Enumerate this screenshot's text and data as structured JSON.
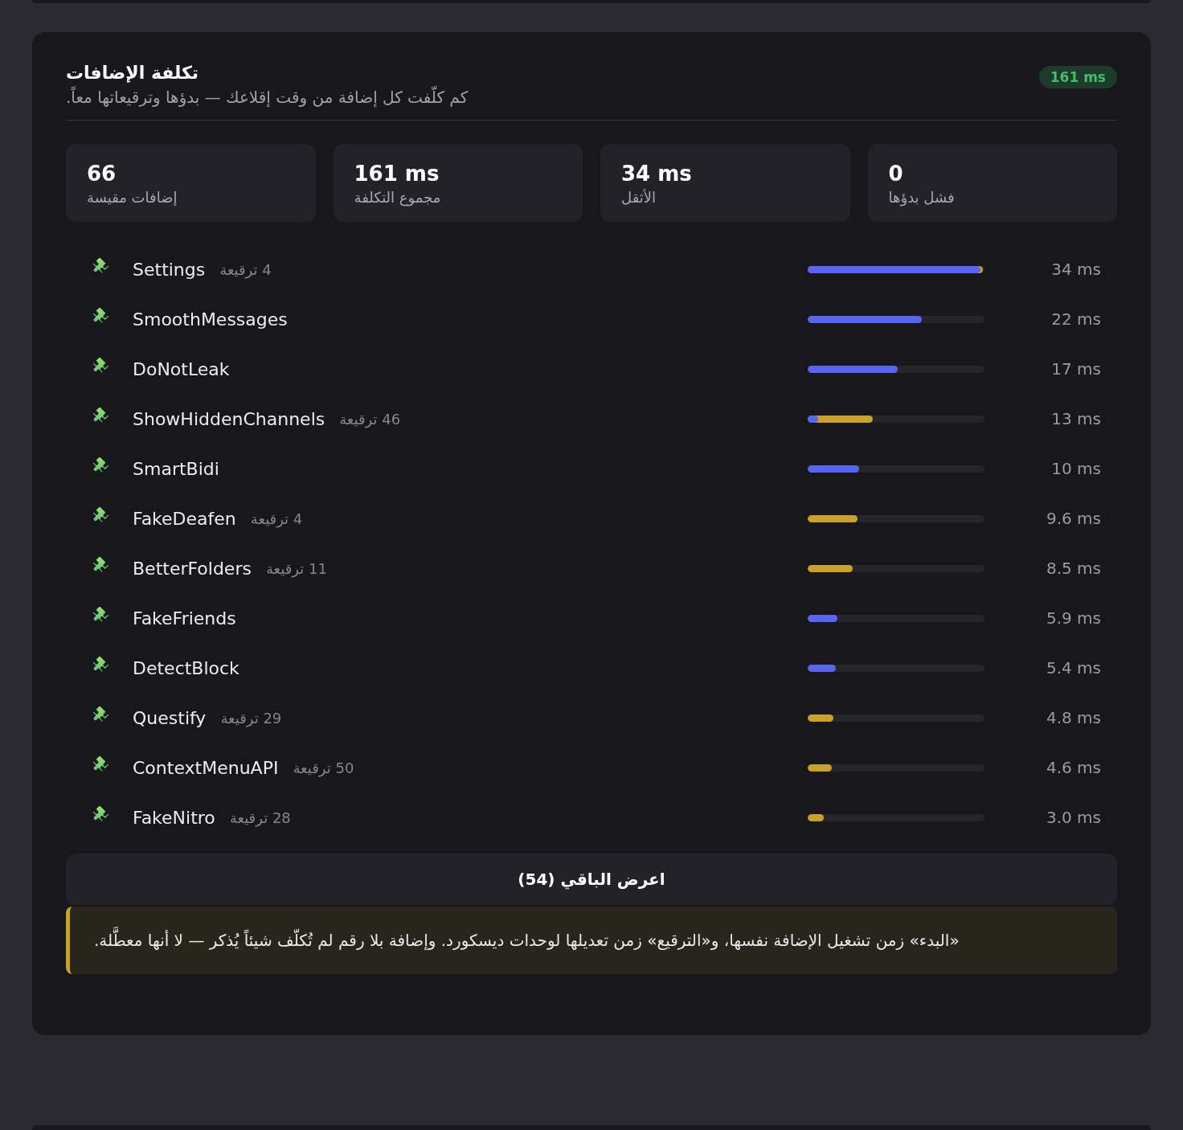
{
  "header": {
    "title": "تكلفة الإضافات",
    "subtitle": "كم كلّفت كل إضافة من وقت إقلاعك — بدؤها وترقيعاتها معاً.",
    "badge": "161 ms"
  },
  "stats": [
    {
      "value": "0",
      "label": "فشل بدؤها"
    },
    {
      "value": "34 ms",
      "label": "الأثقل"
    },
    {
      "value": "161 ms",
      "label": "مجموع التكلفة"
    },
    {
      "value": "66",
      "label": "إضافات مقيسة"
    }
  ],
  "plugins": [
    {
      "name": "Settings",
      "patches": "4 ترقيعة",
      "time": "34 ms",
      "bars": [
        {
          "kind": "start",
          "level": 0.975
        },
        {
          "kind": "patch",
          "level": 0.99
        }
      ]
    },
    {
      "name": "SmoothMessages",
      "time": "22 ms",
      "bars": [
        {
          "kind": "start",
          "level": 0.645
        }
      ]
    },
    {
      "name": "DoNotLeak",
      "time": "17 ms",
      "bars": [
        {
          "kind": "start",
          "level": 0.51
        }
      ]
    },
    {
      "name": "ShowHiddenChannels",
      "patches": "46 ترقيعة",
      "time": "13 ms",
      "bars": [
        {
          "kind": "start",
          "level": 0.06
        },
        {
          "kind": "patch",
          "level": 0.37
        }
      ]
    },
    {
      "name": "SmartBidi",
      "time": "10 ms",
      "bars": [
        {
          "kind": "start",
          "level": 0.29
        }
      ]
    },
    {
      "name": "FakeDeafen",
      "patches": "4 ترقيعة",
      "time": "9.6 ms",
      "bars": [
        {
          "kind": "patch",
          "level": 0.28
        }
      ]
    },
    {
      "name": "BetterFolders",
      "patches": "11 ترقيعة",
      "time": "8.5 ms",
      "bars": [
        {
          "kind": "patch",
          "level": 0.255
        }
      ]
    },
    {
      "name": "FakeFriends",
      "time": "5.9 ms",
      "bars": [
        {
          "kind": "start",
          "level": 0.17
        }
      ]
    },
    {
      "name": "DetectBlock",
      "time": "5.4 ms",
      "bars": [
        {
          "kind": "start",
          "level": 0.16
        }
      ]
    },
    {
      "name": "Questify",
      "patches": "29 ترقيعة",
      "time": "4.8 ms",
      "bars": [
        {
          "kind": "patch",
          "level": 0.145
        }
      ]
    },
    {
      "name": "ContextMenuAPI",
      "patches": "50 ترقيعة",
      "time": "4.6 ms",
      "bars": [
        {
          "kind": "patch",
          "level": 0.135
        }
      ]
    },
    {
      "name": "FakeNitro",
      "patches": "28 ترقيعة",
      "time": "3.0 ms",
      "bars": [
        {
          "kind": "patch",
          "level": 0.09
        }
      ]
    }
  ],
  "show_more": "اعرض الباقي (54)",
  "note": "«البدء» زمن تشغيل الإضافة نفسها، و«الترقيع» زمن تعديلها لوحدات ديسكورد. وإضافة بلا رقم لم تُكلّف شيئاً يُذكر — لا أنها معطَّلة."
}
